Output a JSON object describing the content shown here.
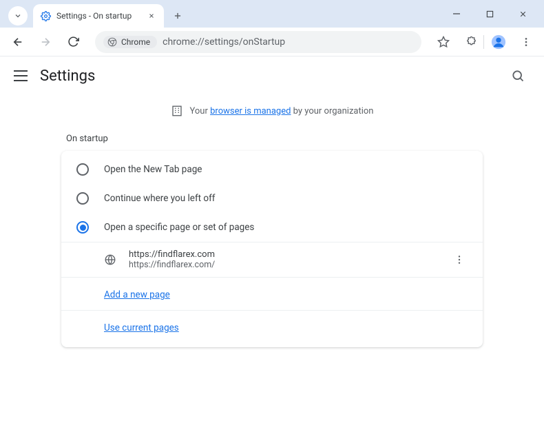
{
  "titlebar": {
    "tab_title": "Settings - On startup"
  },
  "toolbar": {
    "site_chip": "Chrome",
    "url": "chrome://settings/onStartup"
  },
  "header": {
    "title": "Settings"
  },
  "managed": {
    "prefix": "Your ",
    "link": "browser is managed",
    "suffix": " by your organization"
  },
  "section_label": "On startup",
  "options": {
    "o1": "Open the New Tab page",
    "o2": "Continue where you left off",
    "o3": "Open a specific page or set of pages"
  },
  "page": {
    "title": "https://findflarex.com",
    "url": "https://findflarex.com/"
  },
  "links": {
    "add": "Add a new page",
    "use": "Use current pages"
  }
}
